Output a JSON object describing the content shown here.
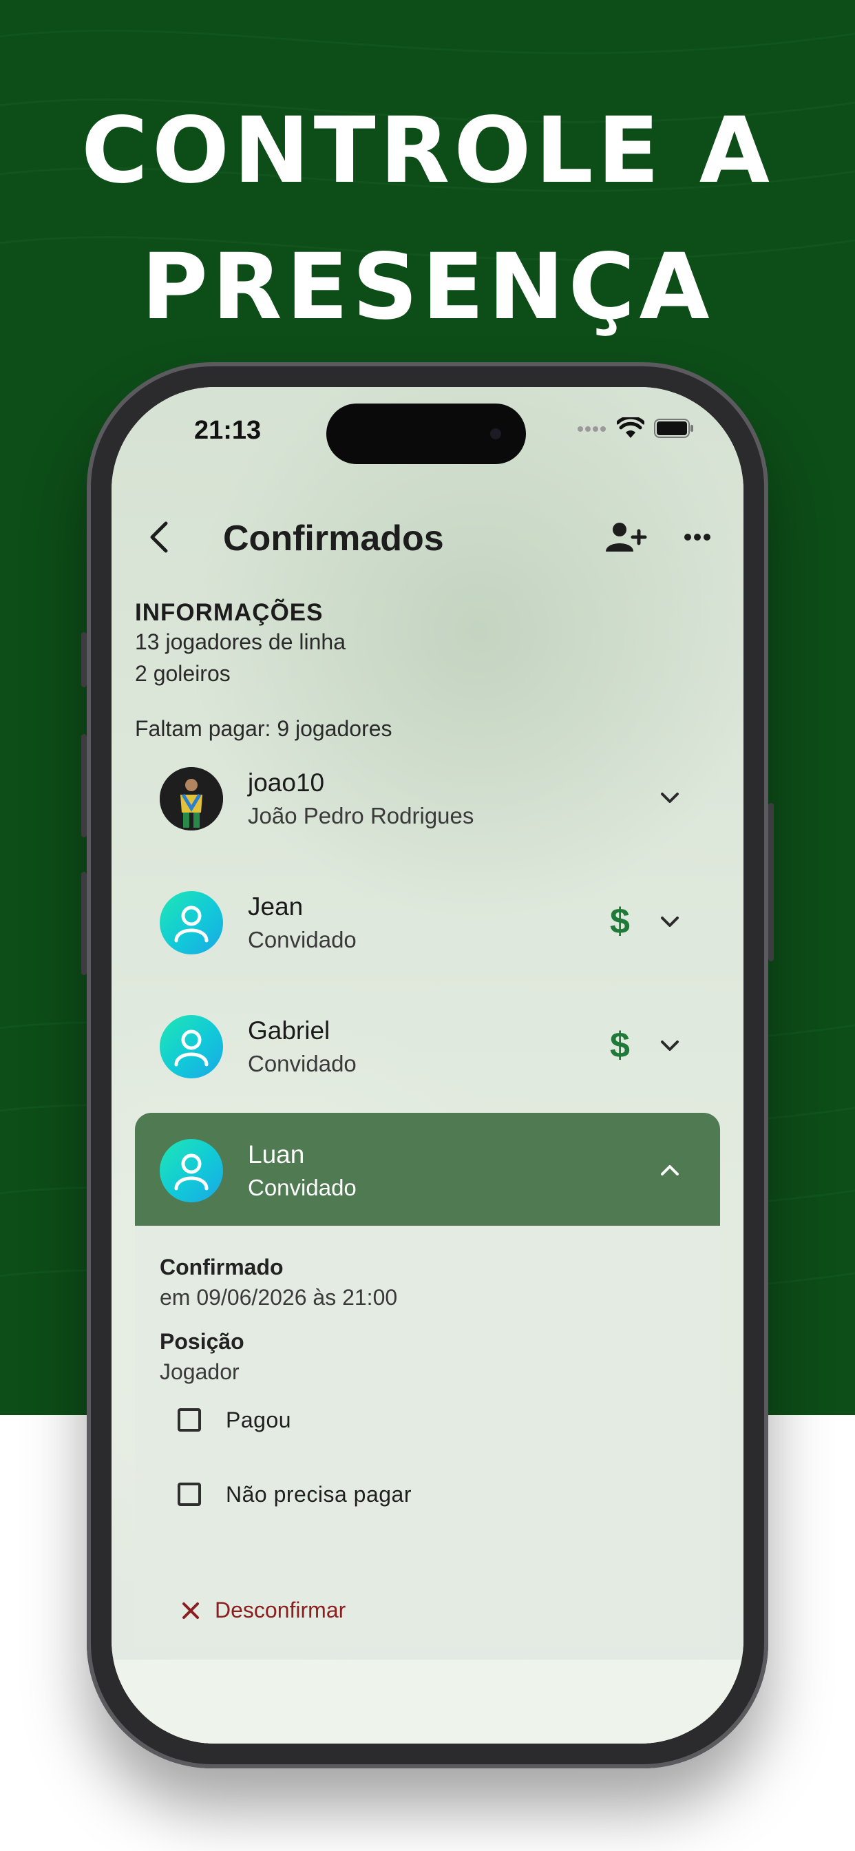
{
  "promo": {
    "headline_line1": "CONTROLE A",
    "headline_line2": "PRESENÇA"
  },
  "status_bar": {
    "time": "21:13",
    "icons": [
      "signal-dots-icon",
      "wifi-icon",
      "battery-icon"
    ]
  },
  "app_bar": {
    "title": "Confirmados",
    "icons": [
      "back-icon",
      "add-user-icon",
      "more-icon"
    ]
  },
  "info": {
    "heading": "INFORMAÇÕES",
    "line_players": "13 jogadores de linha",
    "line_goalkeepers": "2 goleiros",
    "pending_payment": "Faltam pagar: 9 jogadores"
  },
  "players": [
    {
      "name": "joao10",
      "subtitle": "João Pedro Rodrigues",
      "avatar": "photo",
      "payment_icon": false,
      "expanded": false
    },
    {
      "name": "Jean",
      "subtitle": "Convidado",
      "avatar": "guest-icon",
      "payment_icon": "$",
      "expanded": false
    },
    {
      "name": "Gabriel",
      "subtitle": "Convidado",
      "avatar": "guest-icon",
      "payment_icon": "$",
      "expanded": false
    },
    {
      "name": "Luan",
      "subtitle": "Convidado",
      "avatar": "guest-icon",
      "payment_icon": false,
      "expanded": true
    }
  ],
  "expanded_details": {
    "confirmed_label": "Confirmado",
    "confirmed_value": "em 09/06/2026 às 21:00",
    "position_label": "Posição",
    "position_value": "Jogador",
    "checkbox_paid": {
      "label": "Pagou",
      "checked": false
    },
    "checkbox_no_pay": {
      "label": "Não precisa pagar",
      "checked": false
    },
    "unconfirm_label": "Desconfirmar"
  },
  "colors": {
    "promo_green": "#0d4d18",
    "expanded_header": "#4f7a52",
    "dollar_green": "#1f7a3a",
    "unconfirm_red": "#8b1e1e"
  }
}
